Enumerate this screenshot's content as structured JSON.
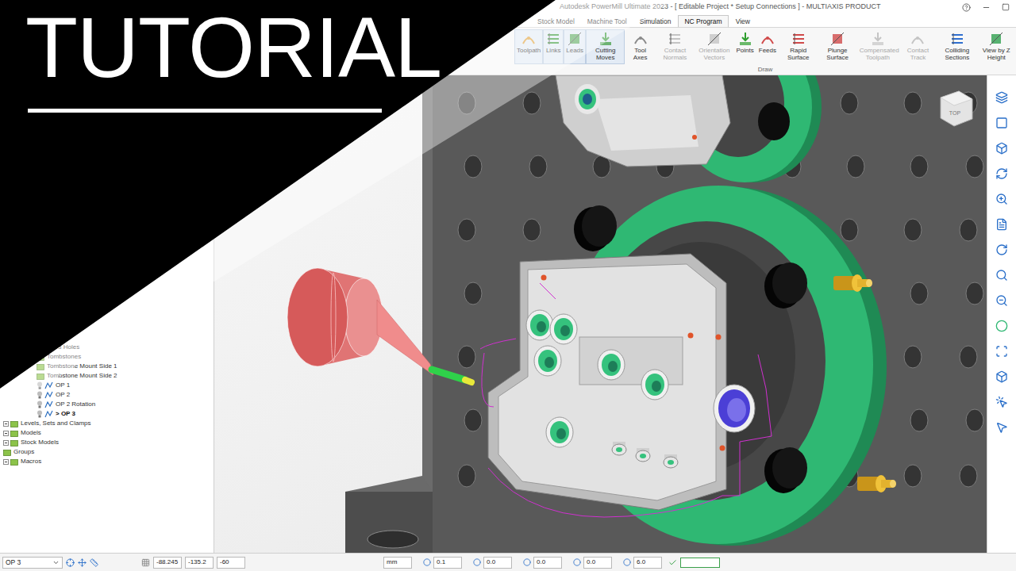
{
  "window": {
    "title": "Autodesk PowerMill Ultimate 2023 - [ Editable Project * Setup Connections ] - MULTIAXIS PRODUCT"
  },
  "overlay": {
    "heading": "TUTORIAL"
  },
  "menu_tabs": [
    {
      "label": "Stock Model",
      "selected": false
    },
    {
      "label": "Machine Tool",
      "selected": false
    },
    {
      "label": "Simulation",
      "selected": false
    },
    {
      "label": "NC Program",
      "selected": true
    },
    {
      "label": "View",
      "selected": false
    }
  ],
  "ribbon": {
    "group": "Draw",
    "buttons": [
      {
        "label": "Toolpath",
        "active": true,
        "disabled": false
      },
      {
        "label": "Links",
        "active": true,
        "disabled": false
      },
      {
        "label": "Leads",
        "active": true,
        "disabled": false
      },
      {
        "label": "Cutting Moves",
        "active": true,
        "disabled": false
      },
      {
        "label": "Tool Axes",
        "active": false,
        "disabled": false
      },
      {
        "label": "Contact Normals",
        "active": false,
        "disabled": true
      },
      {
        "label": "Orientation Vectors",
        "active": false,
        "disabled": true
      },
      {
        "label": "Points",
        "active": false,
        "disabled": false
      },
      {
        "label": "Feeds",
        "active": false,
        "disabled": false
      },
      {
        "label": "Rapid Surface",
        "active": false,
        "disabled": false
      },
      {
        "label": "Plunge Surface",
        "active": false,
        "disabled": false
      },
      {
        "label": "Compensated Toolpath",
        "active": false,
        "disabled": true
      },
      {
        "label": "Contact Track",
        "active": false,
        "disabled": true
      },
      {
        "label": "Colliding Sections",
        "active": false,
        "disabled": false
      },
      {
        "label": "View by Z Height",
        "active": false,
        "disabled": false
      }
    ]
  },
  "explorer": {
    "items": [
      {
        "label": "3 Holes",
        "depth": 4,
        "kind": "item",
        "expandable": false,
        "active": false
      },
      {
        "label": "Tombstones",
        "depth": 3,
        "kind": "folder",
        "expandable": false,
        "active": false
      },
      {
        "label": "Tombstone Mount Side 1",
        "depth": 3,
        "kind": "folder",
        "expandable": false,
        "active": false
      },
      {
        "label": "Tombstone Mount Side 2",
        "depth": 3,
        "kind": "folder",
        "expandable": false,
        "active": false
      },
      {
        "label": "OP 1",
        "depth": 3,
        "kind": "op",
        "expandable": false,
        "active": false
      },
      {
        "label": "OP 2",
        "depth": 3,
        "kind": "op",
        "expandable": false,
        "active": false
      },
      {
        "label": "OP 2 Rotation",
        "depth": 3,
        "kind": "op",
        "expandable": false,
        "active": false
      },
      {
        "label": "> OP 3",
        "depth": 3,
        "kind": "op",
        "expandable": false,
        "active": true
      },
      {
        "label": "Levels, Sets and Clamps",
        "depth": 0,
        "kind": "folder",
        "expandable": true,
        "active": false
      },
      {
        "label": "Models",
        "depth": 0,
        "kind": "folder",
        "expandable": true,
        "active": false
      },
      {
        "label": "Stock Models",
        "depth": 0,
        "kind": "folder",
        "expandable": true,
        "active": false
      },
      {
        "label": "Groups",
        "depth": 0,
        "kind": "folder",
        "expandable": false,
        "active": false
      },
      {
        "label": "Macros",
        "depth": 0,
        "kind": "folder",
        "expandable": true,
        "active": false
      }
    ]
  },
  "viewport": {
    "view_cube": "TOP"
  },
  "status_bar": {
    "toolpath": "OP 3",
    "coords": [
      "-88.245",
      "-135.2",
      "-60"
    ],
    "units": "mm",
    "fields": [
      "0.1",
      "0.0",
      "0.0",
      "0.0",
      "6.0"
    ]
  }
}
